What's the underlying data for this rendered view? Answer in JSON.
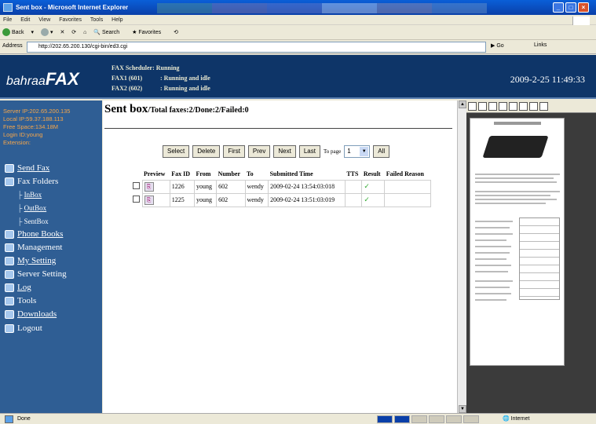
{
  "window": {
    "title": "Sent box - Microsoft Internet Explorer"
  },
  "menu": [
    "File",
    "Edit",
    "View",
    "Favorites",
    "Tools",
    "Help"
  ],
  "toolbar": {
    "back": "Back",
    "search": "Search",
    "favorites": "Favorites"
  },
  "address": {
    "label": "Address",
    "url": "http://202.65.200.130/cgi-bin/ed3.cgi",
    "go": "Go",
    "links": "Links"
  },
  "header": {
    "brand_a": "bahraa",
    "brand_b": "FAX",
    "scheduler_label": "FAX Scheduler:",
    "scheduler_value": "Running",
    "fax1_label": "FAX1 (601)",
    "fax1_value": ": Running and idle",
    "fax2_label": "FAX2 (602)",
    "fax2_value": ": Running and idle",
    "datetime": "2009-2-25 11:49:33"
  },
  "sidebar": {
    "server_ip": "Server IP:202.65.200.135",
    "local_ip": "Local IP:59.37.188.113",
    "free_space": "Free Space:134.18M",
    "login_id": "Login ID:young",
    "extension": "Extension:",
    "nav": {
      "send_fax": "Send Fax",
      "fax_folders": "Fax Folders",
      "inbox": "InBox",
      "outbox": "OutBox",
      "sentbox": "SentBox",
      "phone_books": "Phone Books",
      "management": "Management",
      "my_setting": "My Setting",
      "server_setting": "Server Setting",
      "log": "Log",
      "tools": "Tools",
      "downloads": "Downloads",
      "logout": "Logout"
    }
  },
  "main": {
    "title": "Sent box",
    "summary": "/Total faxes:2/Done:2/Failed:0",
    "buttons": {
      "select": "Select",
      "delete": "Delete",
      "first": "First",
      "prev": "Prev",
      "next": "Next",
      "last": "Last",
      "all": "All"
    },
    "page_label": "To page",
    "page_value": "1",
    "columns": [
      "Preview",
      "Fax ID",
      "From",
      "Number",
      "To",
      "Submitted Time",
      "TTS",
      "Result",
      "Failed Reason"
    ],
    "rows": [
      {
        "fax_id": "1226",
        "from": "young",
        "number": "602",
        "to": "wendy",
        "time": "2009-02-24 13:54:03:018",
        "tts": "",
        "result": "✓",
        "reason": ""
      },
      {
        "fax_id": "1225",
        "from": "young",
        "number": "602",
        "to": "wendy",
        "time": "2009-02-24 13:51:03:019",
        "tts": "",
        "result": "✓",
        "reason": ""
      }
    ]
  },
  "statusbar": {
    "done": "Done",
    "zone": "Internet"
  },
  "colors": {
    "header_bg": "#0e3568",
    "sidebar_bg": "#2f5e94",
    "sidebar_info": "#f6a64a",
    "titlebar": "#0a3fa8"
  }
}
